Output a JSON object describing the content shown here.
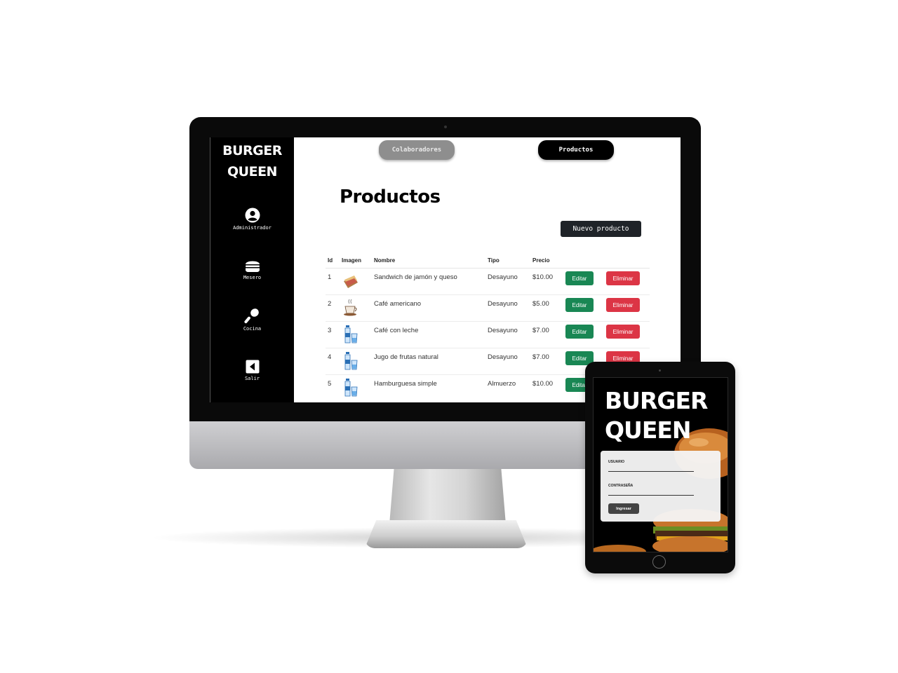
{
  "desktop": {
    "brand": {
      "line1": "BURGER",
      "line2": "QUEEN"
    },
    "sidebar": {
      "items": [
        {
          "label": "Administrador",
          "icon": "user-circle-icon"
        },
        {
          "label": "Mesero",
          "icon": "burger-icon"
        },
        {
          "label": "Cocina",
          "icon": "spatula-icon"
        },
        {
          "label": "Salir",
          "icon": "logout-icon"
        }
      ]
    },
    "tabs": [
      {
        "label": "Colaboradores",
        "active": false
      },
      {
        "label": "Productos",
        "active": true
      }
    ],
    "page_title": "Productos",
    "new_product_button": "Nuevo producto",
    "table": {
      "headers": [
        "Id",
        "Imagen",
        "Nombre",
        "Tipo",
        "Precio"
      ],
      "edit_label": "Editar",
      "delete_label": "Eliminar",
      "rows": [
        {
          "id": "1",
          "image": "sandwich-icon",
          "name": "Sandwich de jamón y queso",
          "tipo": "Desayuno",
          "precio": "$10.00"
        },
        {
          "id": "2",
          "image": "coffee-cup-icon",
          "name": "Café americano",
          "tipo": "Desayuno",
          "precio": "$5.00"
        },
        {
          "id": "3",
          "image": "bottle-glass-icon",
          "name": "Café con leche",
          "tipo": "Desayuno",
          "precio": "$7.00"
        },
        {
          "id": "4",
          "image": "bottle-glass-icon",
          "name": "Jugo de frutas natural",
          "tipo": "Desayuno",
          "precio": "$7.00"
        },
        {
          "id": "5",
          "image": "bottle-glass-icon",
          "name": "Hamburguesa simple",
          "tipo": "Almuerzo",
          "precio": "$10.00"
        }
      ]
    }
  },
  "tablet": {
    "brand": {
      "line1": "BURGER",
      "line2": "QUEEN"
    },
    "login": {
      "user_label": "USUARIO",
      "password_label": "CONTRASEÑA",
      "submit_label": "Ingresar"
    }
  },
  "colors": {
    "sidebar_bg": "#000000",
    "edit_green": "#198754",
    "delete_red": "#dc3545",
    "new_button": "#1f2328",
    "inactive_tab": "#8e8e8e"
  }
}
